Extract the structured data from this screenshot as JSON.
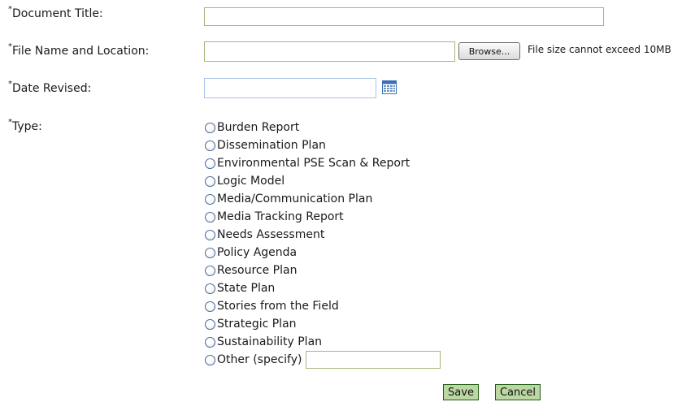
{
  "fields": {
    "document_title": {
      "asterisk": "*",
      "label": "Document Title:",
      "value": ""
    },
    "file": {
      "asterisk": "*",
      "label": "File Name and Location:",
      "value": "",
      "browse_label": "Browse...",
      "hint": "File size cannot exceed 10MB"
    },
    "date_revised": {
      "asterisk": "*",
      "label": "Date Revised:",
      "value": ""
    },
    "type": {
      "asterisk": "*",
      "label": "Type:",
      "options": [
        "Burden Report",
        "Dissemination Plan",
        "Environmental PSE Scan & Report",
        "Logic Model",
        "Media/Communication Plan",
        "Media Tracking Report",
        "Needs Assessment",
        "Policy Agenda",
        "Resource Plan",
        "State Plan",
        "Stories from the Field",
        "Strategic Plan",
        "Sustainability Plan",
        "Other (specify)"
      ],
      "other_value": ""
    }
  },
  "actions": {
    "save_label": "Save",
    "cancel_label": "Cancel"
  },
  "icons": {
    "calendar": "calendar-icon"
  },
  "colors": {
    "input_border": "#a3b77b",
    "date_border": "#a9c4e8",
    "button_bg": "#bcd7a2",
    "button_border": "#1f5c16"
  }
}
